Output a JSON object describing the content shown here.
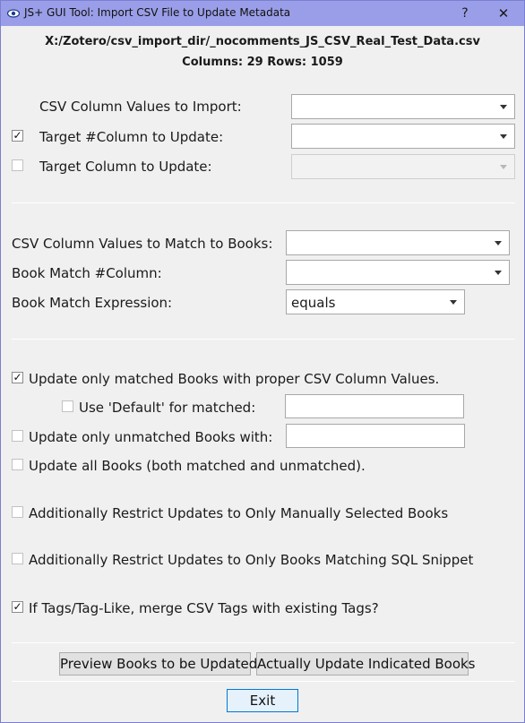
{
  "window": {
    "title": "JS+ GUI Tool:  Import CSV File to Update Metadata",
    "help_label": "?",
    "close_label": "✕",
    "icon": "eye-icon"
  },
  "header": {
    "file_path": "X:/Zotero/csv_import_dir/_nocomments_JS_CSV_Real_Test_Data.csv",
    "counts": "Columns: 29  Rows: 1059"
  },
  "section1": {
    "csv_values_label": "CSV Column Values to Import:",
    "csv_values_selected": "",
    "target_hash_label": "Target #Column to Update:",
    "target_hash_checked": true,
    "target_hash_selected": "",
    "target_label": "Target Column to Update:",
    "target_checked": false,
    "target_selected": ""
  },
  "section2": {
    "match_values_label": "CSV Column Values to Match to Books:",
    "match_values_selected": "",
    "book_match_label": "Book Match #Column:",
    "book_match_selected": "",
    "expression_label": "Book Match Expression:",
    "expression_selected": "equals"
  },
  "section3": {
    "update_matched_label": "Update only matched Books with proper CSV Column Values.",
    "update_matched_checked": true,
    "use_default_label": "Use 'Default' for matched:",
    "use_default_checked": false,
    "use_default_value": "",
    "update_unmatched_label": "Update only unmatched Books with:",
    "update_unmatched_checked": false,
    "update_unmatched_value": "",
    "update_all_label": "Update all Books (both matched and unmatched).",
    "update_all_checked": false,
    "restrict_manual_label": "Additionally Restrict Updates to Only Manually Selected Books",
    "restrict_manual_checked": false,
    "restrict_sql_label": "Additionally Restrict Updates to Only Books Matching SQL Snippet",
    "restrict_sql_checked": false,
    "merge_tags_label": "If Tags/Tag-Like, merge CSV Tags with existing Tags?",
    "merge_tags_checked": true
  },
  "buttons": {
    "preview_label": "Preview Books to be Updated",
    "update_label": "Actually Update Indicated Books",
    "exit_label": "Exit"
  },
  "colors": {
    "titlebar": "#9a9ee8",
    "window_bg": "#f0f0f0",
    "default_button_border": "#0078d7"
  }
}
